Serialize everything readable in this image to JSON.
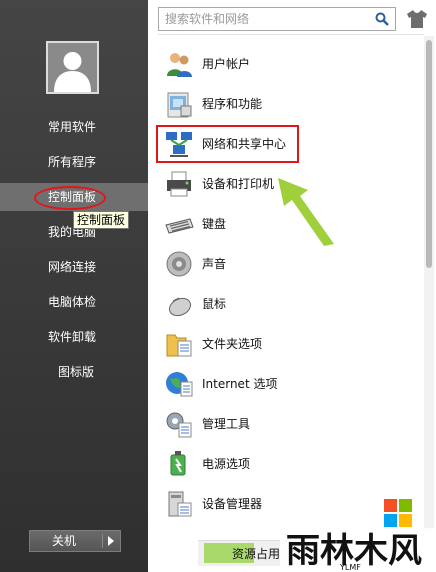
{
  "sidebar": {
    "items": [
      {
        "label": "常用软件"
      },
      {
        "label": "所有程序"
      },
      {
        "label": "控制面板"
      },
      {
        "label": "我的电脑"
      },
      {
        "label": "网络连接"
      },
      {
        "label": "电脑体检"
      },
      {
        "label": "软件卸载"
      },
      {
        "label": "图标版"
      }
    ],
    "active_index": 2,
    "tooltip": "控制面板",
    "shutdown_label": "关机"
  },
  "search": {
    "placeholder": "搜索软件和网络",
    "value": ""
  },
  "control_panel": {
    "items": [
      {
        "label": "用户帐户",
        "icon": "users-icon"
      },
      {
        "label": "程序和功能",
        "icon": "programs-icon"
      },
      {
        "label": "网络和共享中心",
        "icon": "network-icon"
      },
      {
        "label": "设备和打印机",
        "icon": "printer-icon"
      },
      {
        "label": "键盘",
        "icon": "keyboard-icon"
      },
      {
        "label": "声音",
        "icon": "speaker-icon"
      },
      {
        "label": "鼠标",
        "icon": "mouse-icon"
      },
      {
        "label": "文件夹选项",
        "icon": "folder-options-icon"
      },
      {
        "label": "Internet 选项",
        "icon": "internet-icon"
      },
      {
        "label": "管理工具",
        "icon": "admin-tools-icon"
      },
      {
        "label": "电源选项",
        "icon": "power-icon"
      },
      {
        "label": "设备管理器",
        "icon": "device-manager-icon"
      }
    ],
    "highlighted": "网络和共享中心"
  },
  "footer": {
    "label": "资源占用",
    "progress": 0.3
  },
  "colors": {
    "highlight_red": "#e0161b",
    "arrow_green": "#9acd32",
    "sidebar_bg": "#3a3a3a"
  }
}
